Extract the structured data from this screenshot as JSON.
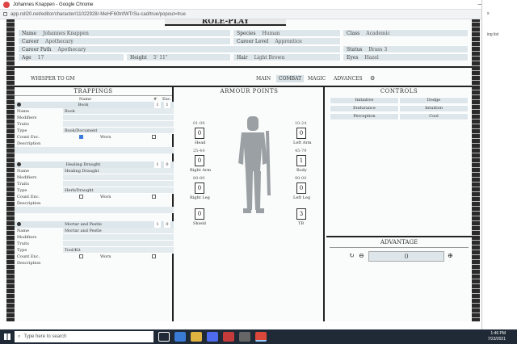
{
  "window": {
    "title": "Johannes Knappen - Google Chrome",
    "url": "app.roll20.net/editor/character/11022928/-MeHF60tnfWTrSu-cad/true/popout=true",
    "controls": [
      "—",
      "□",
      "✕"
    ]
  },
  "side": {
    "line1": "s",
    "line2": "ing list"
  },
  "banner": "ROLE-PLAY",
  "character": {
    "name_label": "Name",
    "name": "Johannes Knappen",
    "species_label": "Species",
    "species": "Human",
    "class_label": "Class",
    "class": "Academic",
    "career_label": "Career",
    "career": "Apothecary",
    "career_level_label": "Career Level",
    "career_level": "Apprentice",
    "career_path_label": "Career Path",
    "career_path": "Apothecary",
    "status_label": "Status",
    "status": "Brass 3",
    "age_label": "Age",
    "age": "17",
    "height_label": "Height",
    "height": "5' 11\"",
    "hair_label": "Hair",
    "hair": "Light Brown",
    "eyes_label": "Eyes",
    "eyes": "Hazel"
  },
  "toolbar": {
    "whisper": "WHISPER TO GM",
    "tabs": [
      "MAIN",
      "COMBAT",
      "MAGIC",
      "ADVANCES"
    ],
    "active_tab": "COMBAT"
  },
  "trappings": {
    "title": "TRAPPINGS",
    "col_name": "Name",
    "col_qty": "#",
    "col_enc": "Enc.",
    "field_labels": {
      "name": "Name",
      "modifiers": "Modifiers",
      "traits": "Traits",
      "type": "Type",
      "count_enc": "Count Enc.",
      "worn": "Worn",
      "description": "Description"
    },
    "items": [
      {
        "title": "Book",
        "qty": "1",
        "enc": "1",
        "name": "Book",
        "type": "Book/Document",
        "count_enc": true,
        "worn": false
      },
      {
        "title": "Healing Draught",
        "qty": "1",
        "enc": "0",
        "name": "Healing Draught",
        "type": "Herb/Draught",
        "count_enc": false,
        "worn": false
      },
      {
        "title": "Mortar and Pestle",
        "qty": "1",
        "enc": "0",
        "name": "Mortar and Pestle",
        "type": "Tool/Kit",
        "count_enc": false,
        "worn": false
      }
    ]
  },
  "armour": {
    "title": "ARMOUR POINTS",
    "locations": [
      {
        "range": "01-09",
        "label": "Head",
        "value": "0"
      },
      {
        "range": "10-24",
        "label": "Left Arm",
        "value": "0"
      },
      {
        "range": "25-44",
        "label": "Right Arm",
        "value": "0"
      },
      {
        "range": "45-79",
        "label": "Body",
        "value": "1"
      },
      {
        "range": "80-89",
        "label": "Right Leg",
        "value": "0"
      },
      {
        "range": "90-00",
        "label": "Left Leg",
        "value": "0"
      },
      {
        "range": "",
        "label": "Shield",
        "value": "0"
      },
      {
        "range": "",
        "label": "TB",
        "value": "3"
      }
    ]
  },
  "controls": {
    "title": "CONTROLS",
    "cells": [
      "Initiative",
      "Dodge",
      "Endurance",
      "Intuition",
      "Perception",
      "Cool"
    ]
  },
  "advantage": {
    "title": "ADVANTAGE",
    "value": "0"
  },
  "taskbar": {
    "search": "Type here to search",
    "time": "1:46 PM",
    "date": "7/23/2021"
  }
}
